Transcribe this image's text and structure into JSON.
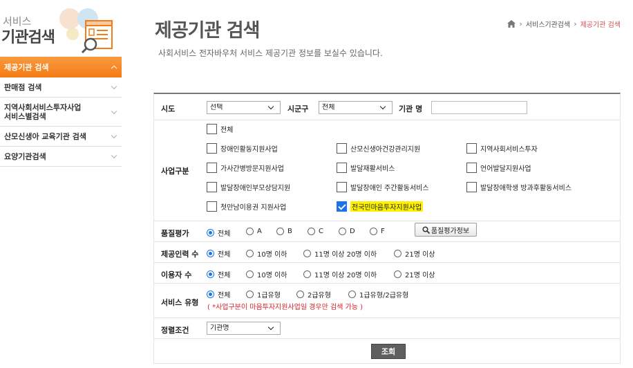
{
  "logo": {
    "line1": "서비스",
    "line2": "기관검색"
  },
  "sidebar": {
    "items": [
      {
        "label": "제공기관 검색"
      },
      {
        "label": "판매점 검색"
      },
      {
        "label": "지역사회서비스투자사업\n서비스별검색"
      },
      {
        "label": "산모신생아 교육기관 검색"
      },
      {
        "label": "요양기관검색"
      }
    ]
  },
  "header": {
    "title": "제공기관 검색",
    "subtitle": "사회서비스 전자바우처 서비스 제공기관 정보를 보실수 있습니다."
  },
  "breadcrumb": {
    "items": [
      "서비스기관검색",
      "제공기관 검색"
    ]
  },
  "form": {
    "region": {
      "sido_label": "시도",
      "sido_value": "선택",
      "sigungu_label": "시군구",
      "sigungu_value": "전체",
      "org_label": "기관 명",
      "org_value": ""
    },
    "business": {
      "label": "사업구분",
      "all": "전체",
      "options": [
        {
          "label": "장애인활동지원사업",
          "checked": false
        },
        {
          "label": "산모신생아건강관리지원",
          "checked": false
        },
        {
          "label": "지역사회서비스투자",
          "checked": false
        },
        {
          "label": "가사간병방문지원사업",
          "checked": false
        },
        {
          "label": "발달재활서비스",
          "checked": false
        },
        {
          "label": "언어발달지원사업",
          "checked": false
        },
        {
          "label": "발달장애인부모상담지원",
          "checked": false
        },
        {
          "label": "발달장애인 주간활동서비스",
          "checked": false
        },
        {
          "label": "발달장애학생 방과후활동서비스",
          "checked": false
        },
        {
          "label": "첫만남이용권 지원사업",
          "checked": false
        },
        {
          "label": "전국민마음투자지원사업",
          "checked": true
        }
      ]
    },
    "quality": {
      "label": "품질평가",
      "options": [
        "전체",
        "A",
        "B",
        "C",
        "D",
        "F"
      ],
      "selected": "전체",
      "button": "품질평가정보"
    },
    "staff": {
      "label": "제공인력 수",
      "options": [
        "전체",
        "10명 이하",
        "11명 이상 20명 이하",
        "21명 이상"
      ],
      "selected": "전체"
    },
    "users": {
      "label": "이용자 수",
      "options": [
        "전체",
        "10명 이하",
        "11명 이상 20명 이하",
        "21명 이상"
      ],
      "selected": "전체"
    },
    "service_type": {
      "label": "서비스 유형",
      "options": [
        "전체",
        "1급유형",
        "2급유형",
        "1급유형/2급유형"
      ],
      "selected": "전체",
      "notice": "( *사업구분이 마음투자지원사업일 경우만 검색 가능 )"
    },
    "sort": {
      "label": "정렬조건",
      "value": "기관명"
    },
    "search_button": "조회"
  },
  "colors": {
    "accent": "#f47b16",
    "highlight": "#fff200",
    "notice": "#d9232d",
    "check": "#1a73e8"
  }
}
